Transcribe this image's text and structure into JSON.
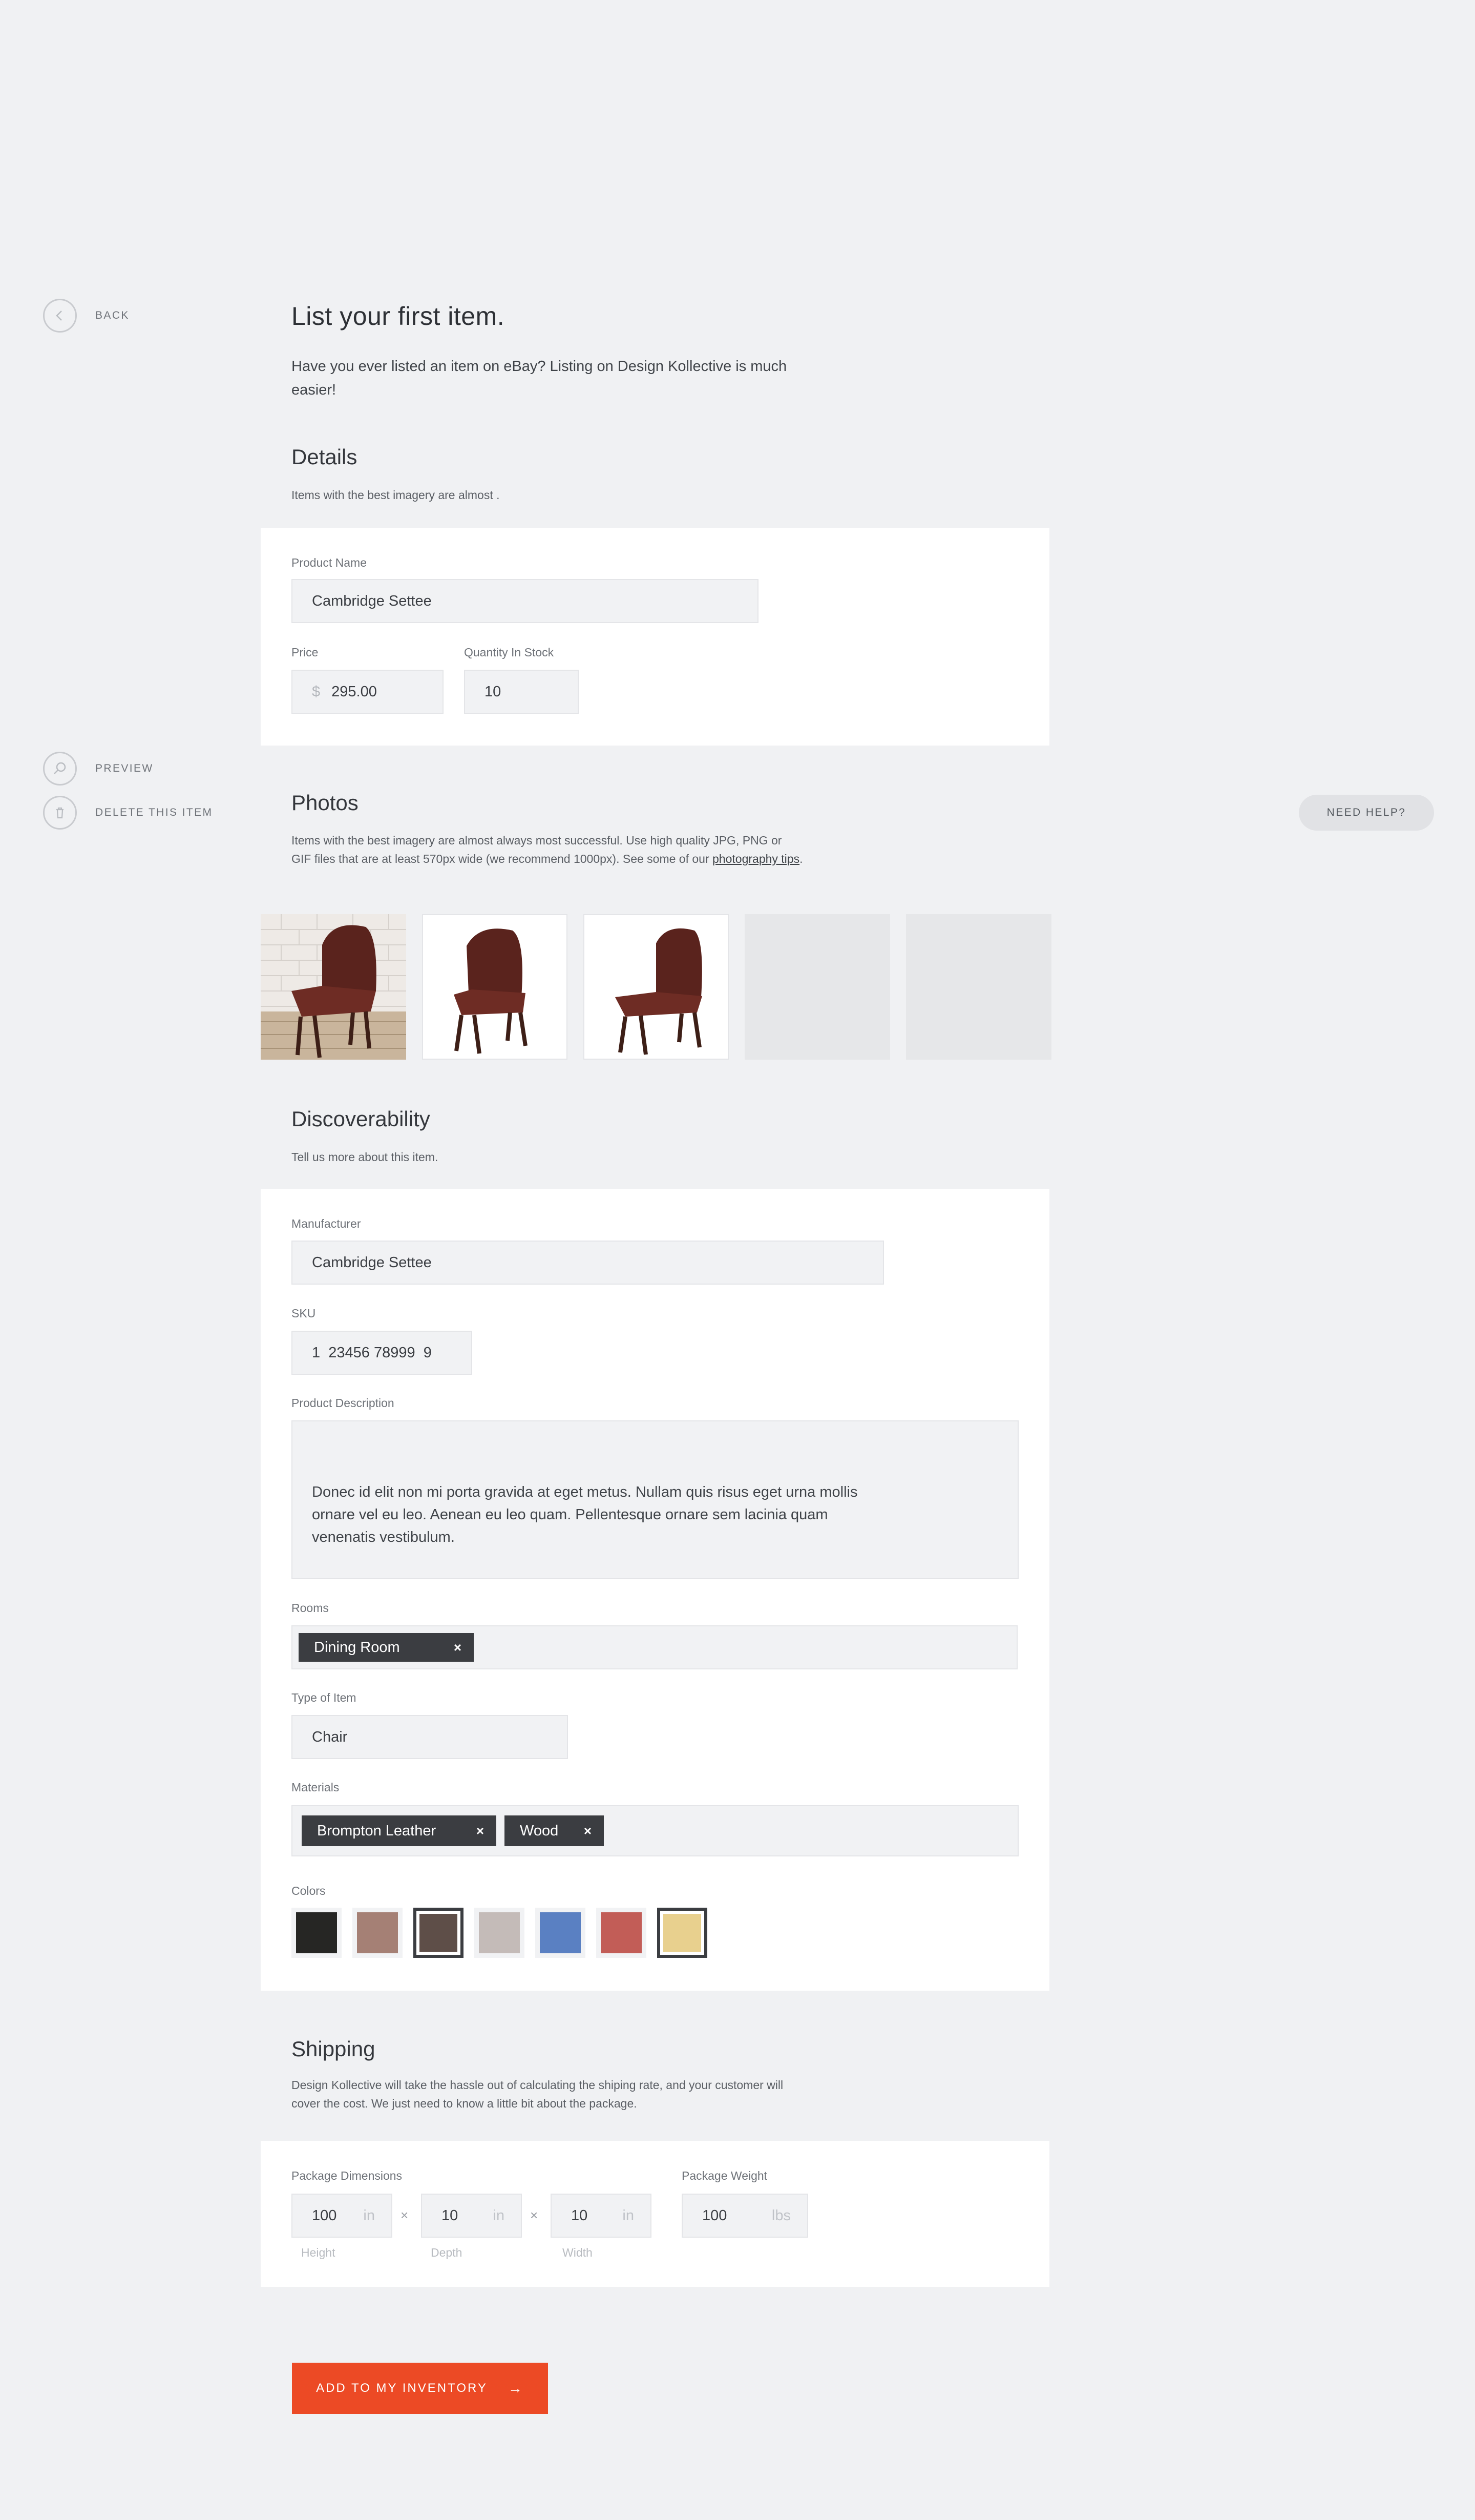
{
  "nav": {
    "back_label": "BACK",
    "preview_label": "PREVIEW",
    "delete_label": "DELETE THIS ITEM",
    "help_label": "NEED HELP?"
  },
  "header": {
    "title": "List your first item.",
    "intro": "Have you ever listed an item on eBay? Listing on Design Kollective is much easier!"
  },
  "details": {
    "title": "Details",
    "subtitle": "Items with the best imagery are almost .",
    "product_name_label": "Product Name",
    "product_name_value": "Cambridge Settee",
    "price_label": "Price",
    "price_prefix": "$",
    "price_value": "295.00",
    "quantity_label": "Quantity In Stock",
    "quantity_value": "10"
  },
  "photos": {
    "title": "Photos",
    "subtitle_pre": "Items with the best imagery are almost always most successful. Use high quality JPG, PNG or GIF files that are at least 570px wide (we recommend 1000px). See some of our ",
    "subtitle_link": "photography tips",
    "subtitle_post": "."
  },
  "discoverability": {
    "title": "Discoverability",
    "subtitle": "Tell us more about this item.",
    "manufacturer_label": "Manufacturer",
    "manufacturer_value": "Cambridge Settee",
    "sku_label": "SKU",
    "sku_value": "1  23456 78999  9",
    "description_label": "Product Description",
    "description_value": "Donec id elit non mi porta gravida at eget metus. Nullam quis risus eget urna mollis ornare vel eu leo. Aenean eu leo quam. Pellentesque ornare sem lacinia quam venenatis vestibulum.",
    "rooms_label": "Rooms",
    "rooms_tags": [
      "Dining Room"
    ],
    "type_label": "Type of Item",
    "type_value": "Chair",
    "materials_label": "Materials",
    "materials_tags": [
      "Brompton Leather",
      "Wood"
    ],
    "tag_remove_glyph": "×",
    "colors_label": "Colors",
    "colors": [
      {
        "hex": "#262624",
        "selected": false
      },
      {
        "hex": "#a58075",
        "selected": false
      },
      {
        "hex": "#5e4e48",
        "selected": true
      },
      {
        "hex": "#c4bbb8",
        "selected": false
      },
      {
        "hex": "#5a80c2",
        "selected": false
      },
      {
        "hex": "#c25d57",
        "selected": false
      },
      {
        "hex": "#e8d08e",
        "selected": true
      }
    ]
  },
  "shipping": {
    "title": "Shipping",
    "subtitle": "Design Kollective will take the hassle out of calculating the shiping rate, and your customer will cover the cost. We just need to know a little bit about the package.",
    "dimensions_label": "Package Dimensions",
    "height_value": "100",
    "depth_value": "10",
    "width_value": "10",
    "dim_unit": "in",
    "times_glyph": "×",
    "height_caption": "Height",
    "depth_caption": "Depth",
    "width_caption": "Width",
    "weight_label": "Package Weight",
    "weight_value": "100",
    "weight_unit": "lbs"
  },
  "cta": {
    "label": "ADD TO MY INVENTORY",
    "arrow": "→"
  },
  "colors": {
    "accent": "#ec4a25",
    "tag_bg": "#3b3d41",
    "page_bg": "#f0f1f3"
  }
}
